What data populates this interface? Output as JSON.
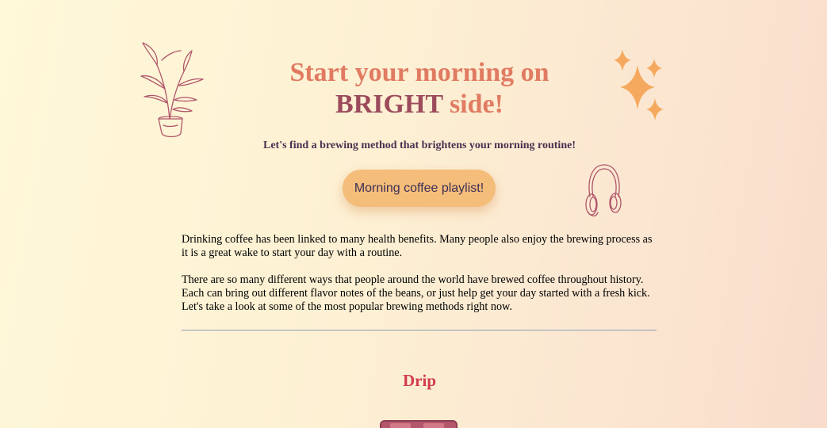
{
  "hero": {
    "title_line1": "Start your morning on",
    "title_bright": "BRIGHT",
    "title_side": " side!",
    "subtitle": "Let's find a brewing method that brightens your morning routine!",
    "playlist_button": "Morning coffee playlist!"
  },
  "intro": {
    "paragraph1": "Drinking coffee has been linked to many health benefits. Many people also enjoy the brewing process as it is a great wake to start your day with a routine.",
    "paragraph2": "There are so many different ways that people around the world have brewed coffee throughout history. Each can bring out different flavor notes of the beans, or just help get your day started with a fresh kick. Let's take a look at some of the most popular brewing methods right now."
  },
  "sections": [
    {
      "heading": "Drip"
    }
  ],
  "icons": {
    "plant": "potted-plant-icon",
    "sparkles": "sparkles-icon",
    "headphones": "headphones-icon"
  },
  "colors": {
    "title": "#e07b62",
    "bright": "#9c4a5c",
    "subtitle": "#4a3050",
    "button_bg": "#f4bd7a",
    "section_heading": "#d13c4e",
    "sparkle": "#f5a95e"
  }
}
